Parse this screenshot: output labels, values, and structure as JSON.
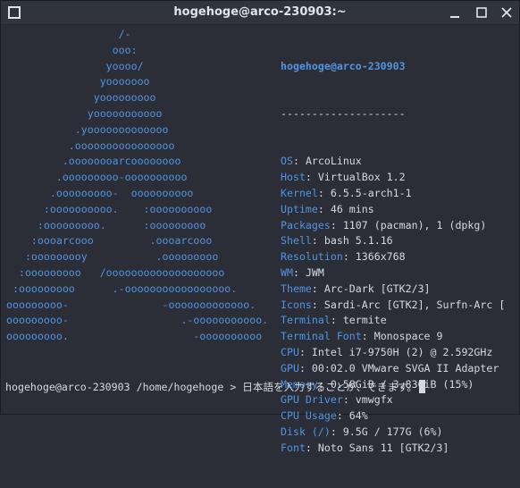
{
  "window": {
    "title": "hogehoge@arco-230903:~"
  },
  "logo_lines": [
    "                  /-",
    "                 ooo:",
    "                yoooo/",
    "               yooooooo",
    "              yooooooooo",
    "             yooooooooooo",
    "           .yooooooooooooo",
    "          .oooooooooooooooo",
    "         .oooooooarcoooooooo",
    "        .ooooooooo-oooooooooo",
    "       .ooooooooo-  oooooooooo",
    "      :oooooooooo.    :oooooooooo",
    "     :ooooooooo.      :ooooooooo",
    "    :oooarcooo         .oooarcooo",
    "   :ooooooooy           .ooooooooo",
    "  :ooooooooo   /ooooooooooooooooooo",
    " :ooooooooo      .-ooooooooooooooooo.",
    "ooooooooo-               -ooooooooooooo.",
    "ooooooooo-                  .-ooooooooooo.",
    "ooooooooo.                    -oooooooooo"
  ],
  "user_host": "hogehoge@arco-230903",
  "separator": "--------------------",
  "info": [
    {
      "key": "OS",
      "sep": ": ",
      "value": "ArcoLinux"
    },
    {
      "key": "Host",
      "sep": ": ",
      "value": "VirtualBox 1.2"
    },
    {
      "key": "Kernel",
      "sep": ": ",
      "value": "6.5.5-arch1-1"
    },
    {
      "key": "Uptime",
      "sep": ": ",
      "value": "46 mins"
    },
    {
      "key": "Packages",
      "sep": ": ",
      "value": "1107 (pacman), 1 (dpkg)"
    },
    {
      "key": "Shell",
      "sep": ": ",
      "value": "bash 5.1.16"
    },
    {
      "key": "Resolution",
      "sep": ": ",
      "value": "1366x768"
    },
    {
      "key": "WM",
      "sep": ": ",
      "value": "JWM"
    },
    {
      "key": "Theme",
      "sep": ": ",
      "value": "Arc-Dark [GTK2/3]"
    },
    {
      "key": "Icons",
      "sep": ": ",
      "value": "Sardi-Arc [GTK2], Surfn-Arc ["
    },
    {
      "key": "Terminal",
      "sep": ": ",
      "value": "termite"
    },
    {
      "key": "Terminal Font",
      "sep": ": ",
      "value": "Monospace 9"
    },
    {
      "key": "CPU",
      "sep": ": ",
      "value": "Intel i7-9750H (2) @ 2.592GHz"
    },
    {
      "key": "GPU",
      "sep": ": ",
      "value": "00:02.0 VMware SVGA II Adapter"
    },
    {
      "key": "Memory",
      "sep": ": ",
      "value": "0.58GiB / 3.83GiB (15%)"
    },
    {
      "key": "GPU Driver",
      "sep": ": ",
      "value": "vmwgfx"
    },
    {
      "key": "CPU Usage",
      "sep": ": ",
      "value": "64%"
    },
    {
      "key": "Disk (/)",
      "sep": ": ",
      "value": "9.5G / 177G (6%)"
    },
    {
      "key": "Font",
      "sep": ": ",
      "value": "Noto Sans 11 [GTK2/3]"
    }
  ],
  "prompt": {
    "user_host": "hogehoge@arco-230903",
    "cwd": "/home/hogehoge",
    "symbol": ">",
    "input": "日本語を入力することが、できます。"
  },
  "colors": {
    "accent": "#5294e2",
    "text": "#d3dae3",
    "background": "#2b2e37",
    "titlebar": "#2f343f"
  },
  "icons": {
    "menu": "window-menu-icon",
    "minimize": "minimize-icon",
    "maximize": "maximize-icon",
    "close": "close-icon"
  }
}
